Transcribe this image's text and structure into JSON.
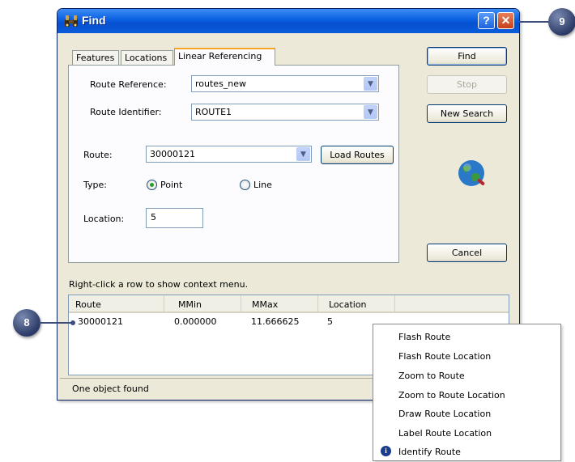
{
  "window": {
    "title": "Find",
    "help_label": "?",
    "close_label": "✕"
  },
  "tabs": [
    {
      "label": "Features",
      "active": false
    },
    {
      "label": "Locations",
      "active": false
    },
    {
      "label": "Linear Referencing",
      "active": true
    }
  ],
  "form": {
    "route_reference_label": "Route Reference:",
    "route_reference_value": "routes_new",
    "route_identifier_label": "Route Identifier:",
    "route_identifier_value": "ROUTE1",
    "route_label": "Route:",
    "route_value": "30000121",
    "load_routes_label": "Load Routes",
    "type_label": "Type:",
    "type_point_label": "Point",
    "type_line_label": "Line",
    "type_selected": "Point",
    "location_label": "Location:",
    "location_value": "5"
  },
  "side_buttons": {
    "find_label": "Find",
    "stop_label": "Stop",
    "new_search_label": "New Search",
    "cancel_label": "Cancel"
  },
  "results": {
    "hint": "Right-click a row to show context menu.",
    "columns": [
      "Route",
      "MMin",
      "MMax",
      "Location"
    ],
    "rows": [
      [
        "30000121",
        "0.000000",
        "11.666625",
        "5"
      ]
    ]
  },
  "status": {
    "text": "One object found"
  },
  "context_menu": {
    "items": [
      {
        "label": "Flash Route",
        "icon": null
      },
      {
        "label": "Flash Route Location",
        "icon": null
      },
      {
        "label": "Zoom to Route",
        "icon": null
      },
      {
        "label": "Zoom to Route Location",
        "icon": null
      },
      {
        "label": "Draw Route Location",
        "icon": null
      },
      {
        "label": "Label Route Location",
        "icon": null
      },
      {
        "label": "Identify Route",
        "icon": "info-icon"
      }
    ]
  },
  "callouts": {
    "callout_9": "9",
    "callout_8": "8"
  },
  "colors": {
    "titlebar": "#0a5fe0",
    "window_bg": "#ece9d8",
    "callout": "#2b3a66",
    "radio_checked": "#21a121"
  },
  "icons": {
    "title_icon": "binoculars-icon",
    "globe": "globe-icon"
  }
}
